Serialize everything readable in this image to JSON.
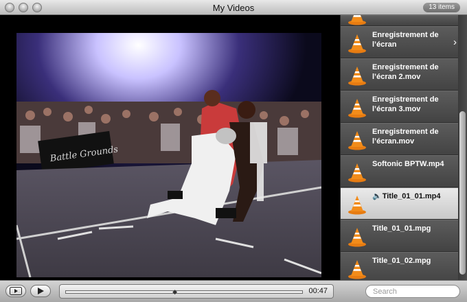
{
  "window": {
    "title": "My Videos",
    "item_count": "13 items"
  },
  "playlist": {
    "items": [
      {
        "label": "",
        "selected": false
      },
      {
        "label": "Enregistrement de l’écran",
        "selected": false,
        "has_chevron": true
      },
      {
        "label": "Enregistrement de l’écran 2.mov",
        "selected": false
      },
      {
        "label": "Enregistrement de l’écran 3.mov",
        "selected": false
      },
      {
        "label": "Enregistrement de l’écran.mov",
        "selected": false
      },
      {
        "label": "Softonic BPTW.mp4",
        "selected": false
      },
      {
        "label": "Title_01_01.mp4",
        "selected": true,
        "now_playing": true
      },
      {
        "label": "Title_01_01.mpg",
        "selected": false
      },
      {
        "label": "Title_01_02.mpg",
        "selected": false
      }
    ],
    "item_icon": "vlc-cone-icon",
    "chevron_icon": "chevron-right-icon",
    "now_playing_icon": "speaker-icon"
  },
  "controls": {
    "time": "00:47",
    "progress": 0.46,
    "search_placeholder": "Search",
    "buttons": [
      "fullscreen-play-button",
      "play-button"
    ]
  },
  "colors": {
    "selected_row": "#d9d9d9",
    "list_bg": "#4a4a4a",
    "video_bg": "#000000"
  }
}
